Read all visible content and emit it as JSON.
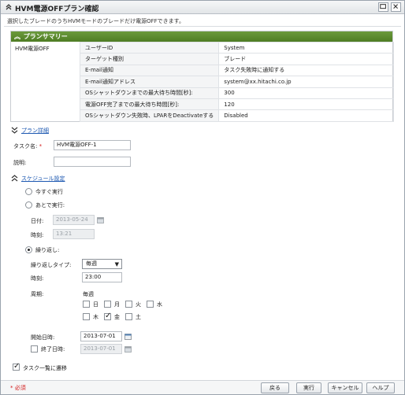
{
  "window": {
    "title": "HVM電源OFFプラン確認"
  },
  "description": "選択したブレードのうちHVMモードのブレードだけ電源OFFできます。",
  "summary": {
    "header": "プランサマリー",
    "left_label": "HVM電源OFF",
    "rows": [
      {
        "key": "ユーザーID",
        "value": "System"
      },
      {
        "key": "ターゲット種別",
        "value": "ブレード"
      },
      {
        "key": "E-mail通知",
        "value": "タスク失敗時に通知する"
      },
      {
        "key": "E-mail通知アドレス",
        "value": "system@xx.hitachi.co.jp"
      },
      {
        "key": "OSシャットダウンまでの最大待ち時間[秒]:",
        "value": "300"
      },
      {
        "key": "電源OFF完了までの最大待ち時間[秒]:",
        "value": "120"
      },
      {
        "key": "OSシャットダウン失敗時、LPARをDeactivateする",
        "value": "Disabled"
      }
    ]
  },
  "plan_detail": {
    "link": "プラン詳細",
    "task_name_label": "タスク名:",
    "required_mark": "*",
    "task_name_value": "HVM電源OFF-1",
    "description_label": "説明:",
    "description_value": ""
  },
  "schedule": {
    "link": "スケジュール設定",
    "now_label": "今すぐ実行",
    "later_label": "あとで実行:",
    "date_label": "日付:",
    "date_value": "2013-05-24",
    "time_label": "時刻:",
    "time_value": "13:21",
    "repeat_label": "繰り返し:",
    "repeat_type_label": "繰り返しタイプ:",
    "repeat_type_value": "毎週",
    "repeat_time_label": "時刻:",
    "repeat_time_value": "23:00",
    "period_label": "周期:",
    "period_value": "毎週",
    "days": [
      {
        "label": "日",
        "checked": false
      },
      {
        "label": "月",
        "checked": false
      },
      {
        "label": "火",
        "checked": false
      },
      {
        "label": "水",
        "checked": false
      },
      {
        "label": "木",
        "checked": false
      },
      {
        "label": "金",
        "checked": true
      },
      {
        "label": "土",
        "checked": false
      }
    ],
    "start_label": "開始日時:",
    "start_value": "2013-07-01",
    "end_label": "終了日時:",
    "end_value": "2013-07-01"
  },
  "go_to_tasks_label": "タスク一覧に遷移",
  "footer": {
    "required_note": "* 必須",
    "back": "戻る",
    "run": "実行",
    "cancel": "キャンセル",
    "help": "ヘルプ"
  }
}
